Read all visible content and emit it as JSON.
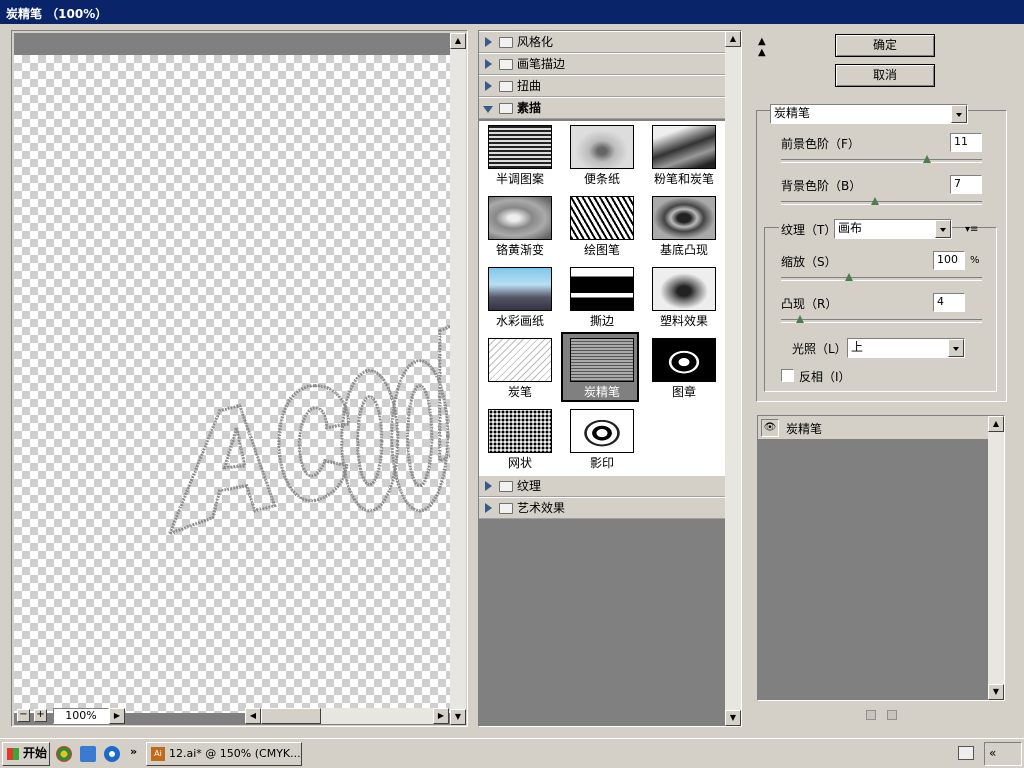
{
  "window": {
    "title": "炭精笔 （100%）"
  },
  "preview": {
    "zoom": "100%",
    "art_text": "Acool"
  },
  "categories": [
    {
      "label": "风格化",
      "open": false
    },
    {
      "label": "画笔描边",
      "open": false
    },
    {
      "label": "扭曲",
      "open": false
    },
    {
      "label": "素描",
      "open": true
    },
    {
      "label": "纹理",
      "open": false
    },
    {
      "label": "艺术效果",
      "open": false
    }
  ],
  "filters": [
    {
      "label": "半调图案",
      "icon": "halftone-thumb"
    },
    {
      "label": "便条纸",
      "icon": "notepaper-thumb"
    },
    {
      "label": "粉笔和炭笔",
      "icon": "chalk-charcoal-thumb"
    },
    {
      "label": "铬黄渐变",
      "icon": "chrome-thumb"
    },
    {
      "label": "绘图笔",
      "icon": "graphic-pen-thumb"
    },
    {
      "label": "基底凸现",
      "icon": "bas-relief-thumb"
    },
    {
      "label": "水彩画纸",
      "icon": "water-paper-thumb"
    },
    {
      "label": "撕边",
      "icon": "torn-edges-thumb"
    },
    {
      "label": "塑料效果",
      "icon": "plaster-thumb"
    },
    {
      "label": "炭笔",
      "icon": "charcoal-thumb"
    },
    {
      "label": "炭精笔",
      "icon": "conte-crayon-thumb",
      "selected": true
    },
    {
      "label": "图章",
      "icon": "stamp-thumb"
    },
    {
      "label": "网状",
      "icon": "reticulation-thumb"
    },
    {
      "label": "影印",
      "icon": "photocopy-thumb"
    }
  ],
  "buttons": {
    "ok": "确定",
    "cancel": "取消"
  },
  "settings": {
    "filter_name": "炭精笔",
    "fg_level_label": "前景色阶（F）",
    "fg_level_value": "11",
    "fg_level_max": 15,
    "bg_level_label": "背景色阶（B）",
    "bg_level_value": "7",
    "bg_level_max": 15,
    "texture_label": "纹理（T）:",
    "texture_value": "画布",
    "scale_label": "缩放（S）",
    "scale_value": "100",
    "scale_unit": "%",
    "scale_min": 50,
    "scale_max": 200,
    "relief_label": "凸现（R）",
    "relief_value": "4",
    "relief_max": 50,
    "light_label": "光照（L）:",
    "light_value": "上",
    "invert_label": "反相（I）",
    "invert_checked": false
  },
  "layers": [
    {
      "label": "炭精笔",
      "visible": true
    }
  ],
  "taskbar": {
    "start_label": "开始",
    "task_label": "12.ai* @ 150% (CMYK...",
    "task_icon": "Ai",
    "tray_label": "«"
  },
  "colors": {
    "titlebar": "#0a246a",
    "panel": "#d4d0c8",
    "dark_panel": "#808080",
    "selected_thumb": "#808080"
  }
}
